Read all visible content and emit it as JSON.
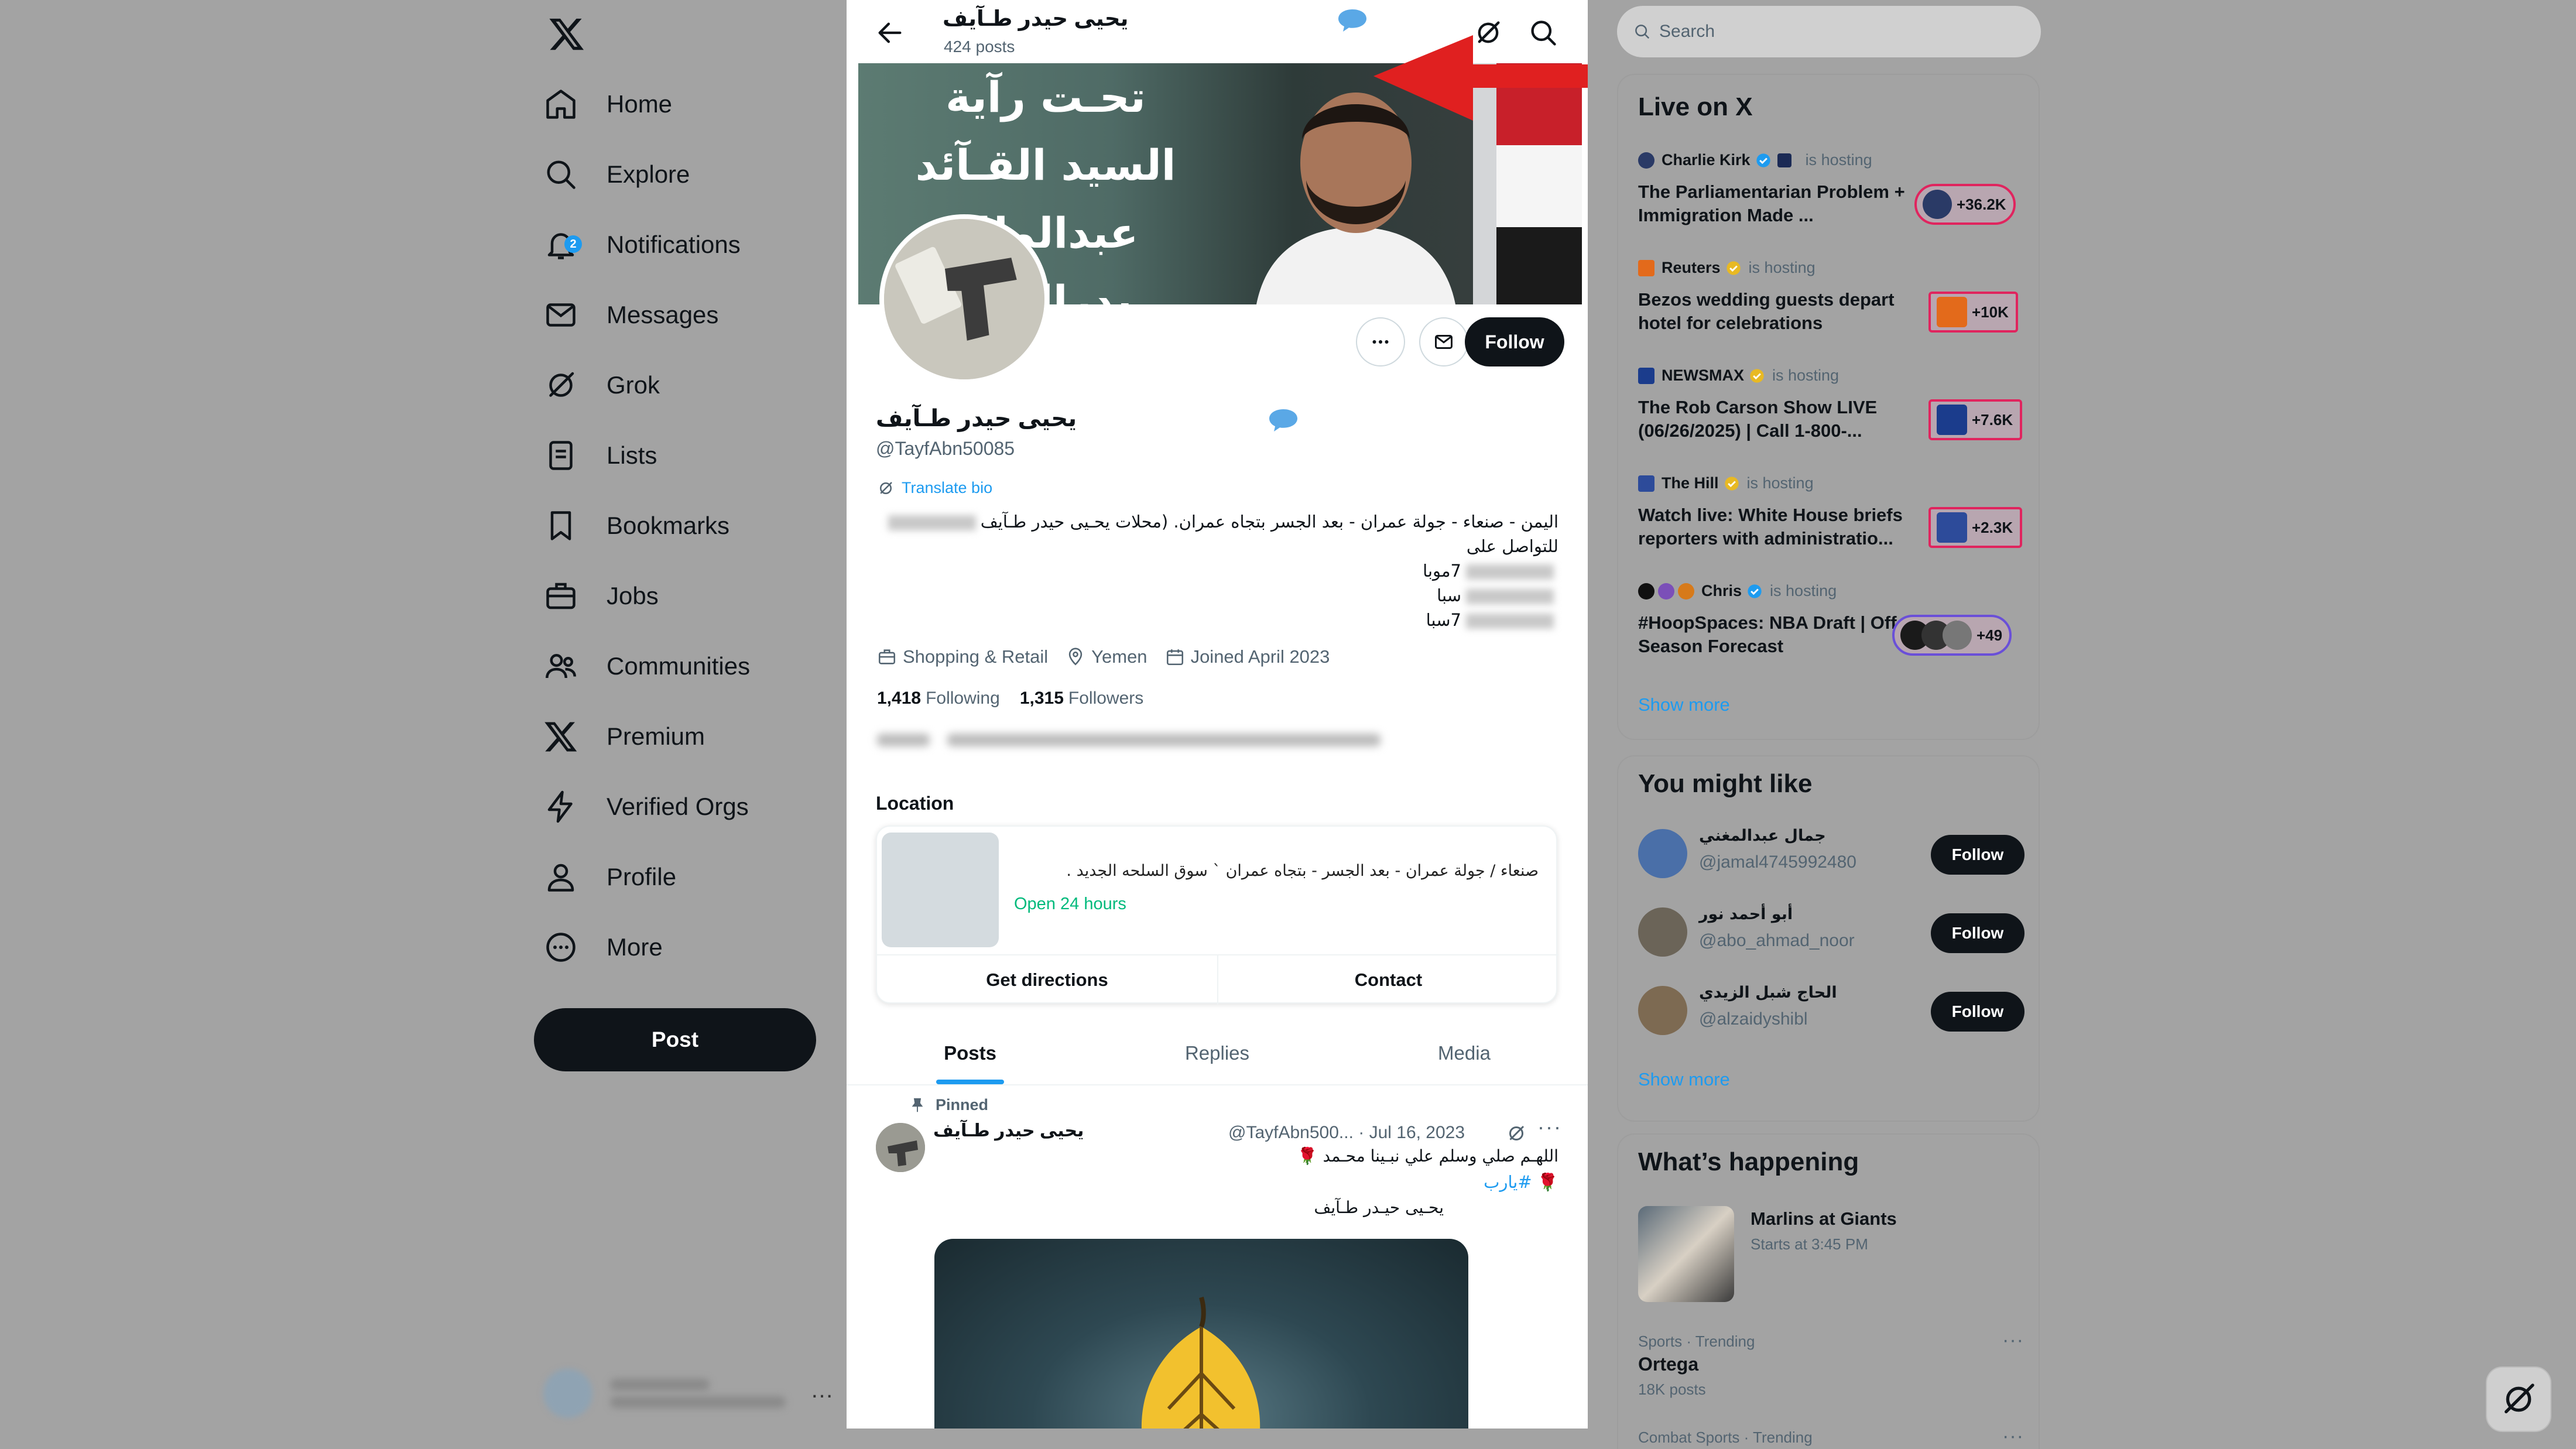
{
  "nav": {
    "logo": "x-logo-icon",
    "items": [
      {
        "label": "Home",
        "icon": "home-icon"
      },
      {
        "label": "Explore",
        "icon": "search-icon"
      },
      {
        "label": "Notifications",
        "icon": "bell-icon",
        "badge": "2"
      },
      {
        "label": "Messages",
        "icon": "mail-icon"
      },
      {
        "label": "Grok",
        "icon": "grok-icon"
      },
      {
        "label": "Lists",
        "icon": "list-icon"
      },
      {
        "label": "Bookmarks",
        "icon": "bookmark-icon"
      },
      {
        "label": "Jobs",
        "icon": "briefcase-icon"
      },
      {
        "label": "Communities",
        "icon": "people-icon"
      },
      {
        "label": "Premium",
        "icon": "x-logo-icon"
      },
      {
        "label": "Verified Orgs",
        "icon": "lightning-icon"
      },
      {
        "label": "Profile",
        "icon": "person-icon"
      },
      {
        "label": "More",
        "icon": "more-circle-icon"
      }
    ],
    "post_label": "Post",
    "account_more": "…"
  },
  "profile": {
    "top_name": "يحيى حيدر طـآيف",
    "post_count": "424 posts",
    "banner_text": "تحـت رآية السيد القـآئد عبدالملك بدرالدين الحوثي جـاهزون",
    "display_name": "يحيى حيدر طـآيف",
    "handle": "@TayfAbn50085",
    "translate_bio": "Translate bio",
    "bio_line1": "اليمن - صنعاء - جولة عمران - بعد الجسر بتجاه عمران. (محلات يحـيى حيدر طـآيف",
    "bio_line2": "للتواصل على",
    "bio_line3": "7موبا",
    "bio_line4": "سبا",
    "bio_line5": "7سبا",
    "category": "Shopping & Retail",
    "location": "Yemen",
    "joined": "Joined April 2023",
    "following_count": "1,418",
    "following_label": "Following",
    "followers_count": "1,315",
    "followers_label": "Followers",
    "follow_label": "Follow"
  },
  "location_card": {
    "title": "Location",
    "address": "صنعاء / جولة عمران - بعد الجسر - بتجاه عمران ` سوق السلحه الجديد .",
    "hours": "Open 24 hours",
    "directions_label": "Get directions",
    "contact_label": "Contact"
  },
  "tabs": [
    "Posts",
    "Replies",
    "Media"
  ],
  "pinned_post": {
    "pinned_label": "Pinned",
    "author": "يحيى حيدر طـآيف",
    "handle_date": "@TayfAbn500... · Jul 16, 2023",
    "line1": "اللهـم صلي وسلم علي نبـينا محـمد 🌹",
    "line2": "🌹 #يارب",
    "line3": "يحـيى حيـدر طـآيف"
  },
  "right": {
    "search_placeholder": "Search",
    "live_title": "Live on X",
    "live": [
      {
        "host": "Charlie Kirk",
        "note": "is hosting",
        "title": "The Parliamentarian Problem + Immigration Made ...",
        "count": "+36.2K",
        "pill_color": "#2a3a66"
      },
      {
        "host": "Reuters",
        "note": "is hosting",
        "title": "Bezos wedding guests depart hotel for celebrations",
        "count": "+10K",
        "pill_color": "#e36a1b"
      },
      {
        "host": "NEWSMAX",
        "note": "is hosting",
        "title": "The Rob Carson Show LIVE (06/26/2025) | Call 1-800-...",
        "count": "+7.6K",
        "pill_color": "#1b3c8c"
      },
      {
        "host": "The Hill",
        "note": "is hosting",
        "title": "Watch live: White House briefs reporters with administratio...",
        "count": "+2.3K",
        "pill_color": "#2d4b9a"
      },
      {
        "host": "Chris",
        "note": "is hosting",
        "title": "#HoopSpaces: NBA Draft | Off-Season Forecast",
        "count": "+49",
        "pill_color": "#222222"
      }
    ],
    "live_show_more": "Show more",
    "suggest_title": "You might like",
    "suggestions": [
      {
        "name": "جمال عبدالمغني",
        "handle": "@jamal4745992480",
        "follow": "Follow"
      },
      {
        "name": "أبو أحمد نور",
        "handle": "@abo_ahmad_noor",
        "follow": "Follow"
      },
      {
        "name": "الحاج شبل الزيدي",
        "handle": "@alzaidyshibl",
        "follow": "Follow"
      }
    ],
    "suggest_show_more": "Show more",
    "happening_title": "What’s happening",
    "event": {
      "title": "Marlins at Giants",
      "time": "Starts at 3:45 PM"
    },
    "trends": [
      {
        "meta": "Sports · Trending",
        "name": "Ortega",
        "count": "18K posts"
      },
      {
        "meta": "Combat Sports · Trending",
        "name": "",
        "count": ""
      }
    ]
  },
  "colors": {
    "accent": "#1d9bf0",
    "live_pill_border": "#e0245e",
    "open_hours": "#00ba7c"
  }
}
